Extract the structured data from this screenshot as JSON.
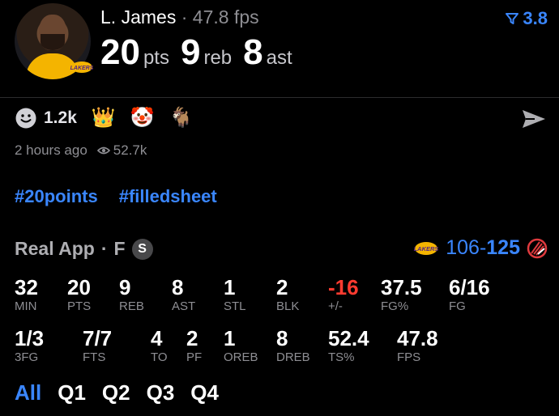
{
  "player": {
    "name": "L. James",
    "separator": "·",
    "fps_label": "47.8 fps",
    "rating": "3.8",
    "pts": "20",
    "pts_unit": "pts",
    "reb": "9",
    "reb_unit": "reb",
    "ast": "8",
    "ast_unit": "ast"
  },
  "reactions": {
    "count": "1.2k",
    "emojis": [
      "crown-emoji",
      "clown-emoji",
      "goat-emoji"
    ]
  },
  "meta": {
    "time": "2 hours ago",
    "views": "52.7k"
  },
  "tags": [
    "#20points",
    "#filledsheet"
  ],
  "game": {
    "source": "Real App",
    "dot": "·",
    "position": "F",
    "badge": "S",
    "home_score": "106",
    "dash": "-",
    "away_score": "125"
  },
  "stats": {
    "row1": [
      {
        "v": "32",
        "l": "MIN"
      },
      {
        "v": "20",
        "l": "PTS"
      },
      {
        "v": "9",
        "l": "REB"
      },
      {
        "v": "8",
        "l": "AST"
      },
      {
        "v": "1",
        "l": "STL"
      },
      {
        "v": "2",
        "l": "BLK"
      },
      {
        "v": "-16",
        "l": "+/-"
      },
      {
        "v": "37.5",
        "l": "FG%"
      },
      {
        "v": "6/16",
        "l": "FG"
      }
    ],
    "row2": [
      {
        "v": "1/3",
        "l": "3FG"
      },
      {
        "v": "7/7",
        "l": "FTS"
      },
      {
        "v": "4",
        "l": "TO"
      },
      {
        "v": "2",
        "l": "PF"
      },
      {
        "v": "1",
        "l": "OREB"
      },
      {
        "v": "8",
        "l": "DREB"
      },
      {
        "v": "52.4",
        "l": "TS%"
      },
      {
        "v": "47.8",
        "l": "FPS"
      }
    ]
  },
  "quarters": [
    "All",
    "Q1",
    "Q2",
    "Q3",
    "Q4"
  ],
  "colors": {
    "accent": "#3a86ff",
    "negative": "#ff3b30",
    "muted": "#8e8e93"
  }
}
